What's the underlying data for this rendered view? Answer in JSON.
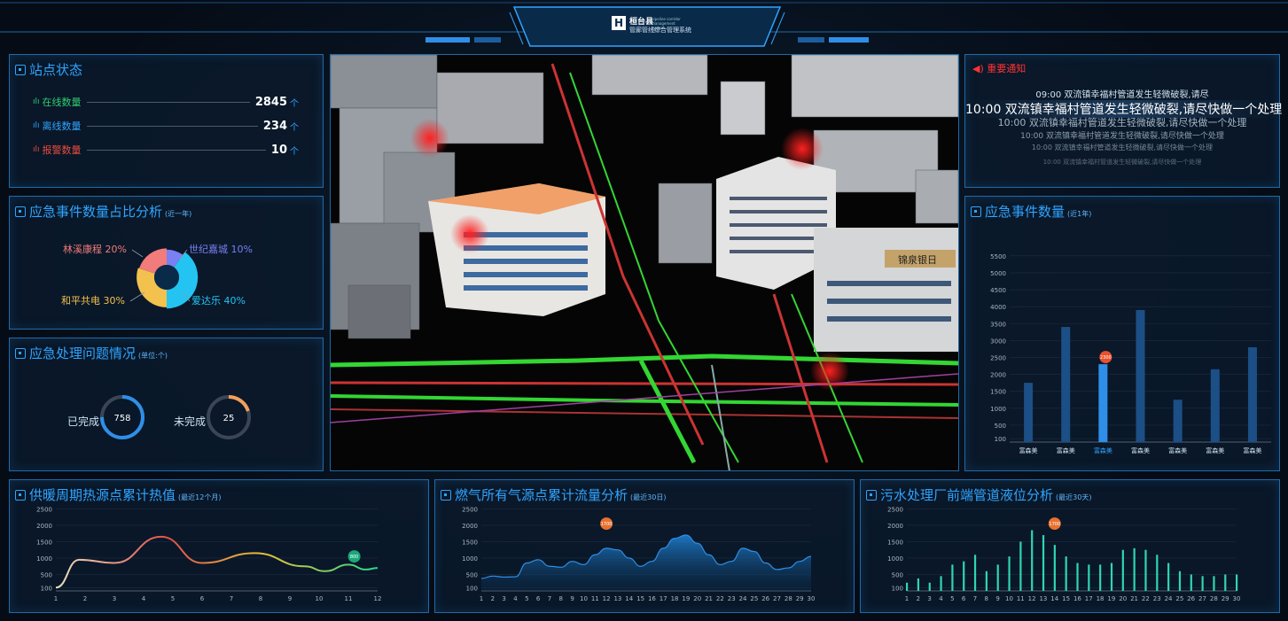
{
  "header": {
    "logo_char": "H",
    "title": "桓台县",
    "title_en": "pipeline corridor management system",
    "subtitle": "管廊管线综合管理系统"
  },
  "station": {
    "title": "站点状态",
    "items": [
      {
        "label": "在线数量",
        "value": "2845",
        "unit": "个",
        "color": "#2ecc71"
      },
      {
        "label": "离线数量",
        "value": "234",
        "unit": "个",
        "color": "#2fa4ff"
      },
      {
        "label": "报警数量",
        "value": "10",
        "unit": "个",
        "color": "#e74c3c"
      }
    ]
  },
  "ratio": {
    "title": "应急事件数量占比分析",
    "sub": "(近一年)",
    "slices": [
      {
        "name": "爱达乐",
        "pct": "40%",
        "value": 40,
        "color": "#23c4f2"
      },
      {
        "name": "和平共电",
        "pct": "30%",
        "value": 30,
        "color": "#f2c14e"
      },
      {
        "name": "林溪康程",
        "pct": "20%",
        "value": 20,
        "color": "#f27b7b"
      },
      {
        "name": "世纪嘉城",
        "pct": "10%",
        "value": 10,
        "color": "#7a7ff2"
      }
    ]
  },
  "handling": {
    "title": "应急处理问题情况",
    "sub": "(单位:个)",
    "done_label": "已完成",
    "done_value": "758",
    "done_frac": 0.75,
    "todo_label": "未完成",
    "todo_value": "25",
    "todo_frac": 0.2
  },
  "notice": {
    "title": "重要通知",
    "lines": [
      {
        "text": "09:00  双流镇幸福村管道发生轻微破裂,请尽",
        "size": 10
      },
      {
        "text": "10:00  双流镇幸福村管道发生轻微破裂,请尽快做一个处理",
        "size": 14
      },
      {
        "text": "10:00  双流镇幸福村管道发生轻微破裂,请尽快做一个处理",
        "size": 11
      },
      {
        "text": "10:00  双流镇幸福村管道发生轻微破裂,请尽快做一个处理",
        "size": 9
      },
      {
        "text": "10:00  双流镇幸福村管道发生轻微破裂,请尽快做一个处理",
        "size": 8
      },
      {
        "text": "10:00  双流镇幸福村管道发生轻微破裂,请尽快做一个处理",
        "size": 7
      }
    ]
  },
  "bar_panel": {
    "title": "应急事件数量",
    "sub": "(近1年)"
  },
  "heat_panel": {
    "title": "供暖周期热源点累计热值",
    "sub": "(最近12个月)"
  },
  "gas_panel": {
    "title": "燃气所有气源点累计流量分析",
    "sub": "(最近30日)"
  },
  "sewage_panel": {
    "title": "污水处理厂前端管道液位分析",
    "sub": "(最近30天)"
  },
  "map": {
    "sign_text": "锦泉银日"
  },
  "chart_data": [
    {
      "type": "bar",
      "title": "应急事件数量",
      "categories": [
        "富森美",
        "富森美",
        "富森美",
        "富森美",
        "富森美",
        "富森美",
        "富森美"
      ],
      "values": [
        1750,
        3400,
        2300,
        3900,
        1250,
        2150,
        2800
      ],
      "highlight_index": 2,
      "highlight_label": "2300",
      "yticks": [
        100,
        500,
        1000,
        1500,
        2000,
        2500,
        3000,
        3500,
        4000,
        4500,
        5000,
        5500
      ],
      "ylim": [
        0,
        5600
      ]
    },
    {
      "type": "line",
      "title": "供暖周期热源点累计热值",
      "x": [
        1,
        2,
        3,
        4,
        5,
        6,
        7,
        8,
        9,
        10,
        11,
        12
      ],
      "points": [
        [
          1,
          100
        ],
        [
          1.8,
          950
        ],
        [
          3,
          850
        ],
        [
          4.6,
          1650
        ],
        [
          6,
          850
        ],
        [
          7.8,
          1150
        ],
        [
          9.5,
          750
        ],
        [
          10.2,
          600
        ],
        [
          11,
          800
        ],
        [
          11.6,
          650
        ],
        [
          12,
          700
        ]
      ],
      "badge_x": 11.2,
      "badge_label": "800",
      "yticks": [
        100,
        500,
        1000,
        1500,
        2000,
        2500
      ],
      "ylim": [
        0,
        2700
      ]
    },
    {
      "type": "area",
      "title": "燃气所有气源点累计流量分析",
      "x": [
        1,
        2,
        3,
        4,
        5,
        6,
        7,
        8,
        9,
        10,
        11,
        12,
        13,
        14,
        15,
        16,
        17,
        18,
        19,
        20,
        21,
        22,
        23,
        24,
        25,
        26,
        27,
        28,
        29,
        30
      ],
      "values": [
        380,
        450,
        420,
        430,
        850,
        950,
        750,
        720,
        900,
        800,
        1100,
        1300,
        1250,
        1000,
        750,
        900,
        1300,
        1600,
        1700,
        1450,
        1100,
        800,
        900,
        1300,
        1200,
        850,
        650,
        700,
        900,
        1050
      ],
      "badge_x": 12,
      "badge_label": "1700",
      "yticks": [
        100,
        500,
        1000,
        1500,
        2000,
        2500
      ],
      "ylim": [
        0,
        2700
      ]
    },
    {
      "type": "bar",
      "title": "污水处理厂前端管道液位分析",
      "x": [
        1,
        2,
        3,
        4,
        5,
        6,
        7,
        8,
        9,
        10,
        11,
        12,
        13,
        14,
        15,
        16,
        17,
        18,
        19,
        20,
        21,
        22,
        23,
        24,
        25,
        26,
        27,
        28,
        29,
        30
      ],
      "values": [
        250,
        380,
        250,
        450,
        800,
        900,
        1100,
        600,
        800,
        1050,
        1500,
        1850,
        1700,
        1400,
        1050,
        850,
        800,
        800,
        850,
        1250,
        1300,
        1250,
        1100,
        850,
        600,
        500,
        450,
        450,
        500,
        500
      ],
      "badge_x": 14,
      "badge_label": "1700",
      "yticks": [
        100,
        500,
        1000,
        1500,
        2000,
        2500
      ],
      "ylim": [
        0,
        2700
      ]
    }
  ]
}
